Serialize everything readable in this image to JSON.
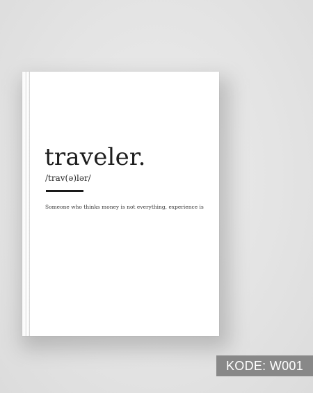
{
  "book": {
    "word": "traveler.",
    "phonetic": "/trav(ə)lər/",
    "definition": "Someone who thinks money is not everything, experience is"
  },
  "badge": {
    "code": "KODE: W001"
  },
  "colors": {
    "background": "#e4e4e4",
    "cover": "#ffffff",
    "text": "#1e1e1e",
    "badge": "#888888"
  }
}
